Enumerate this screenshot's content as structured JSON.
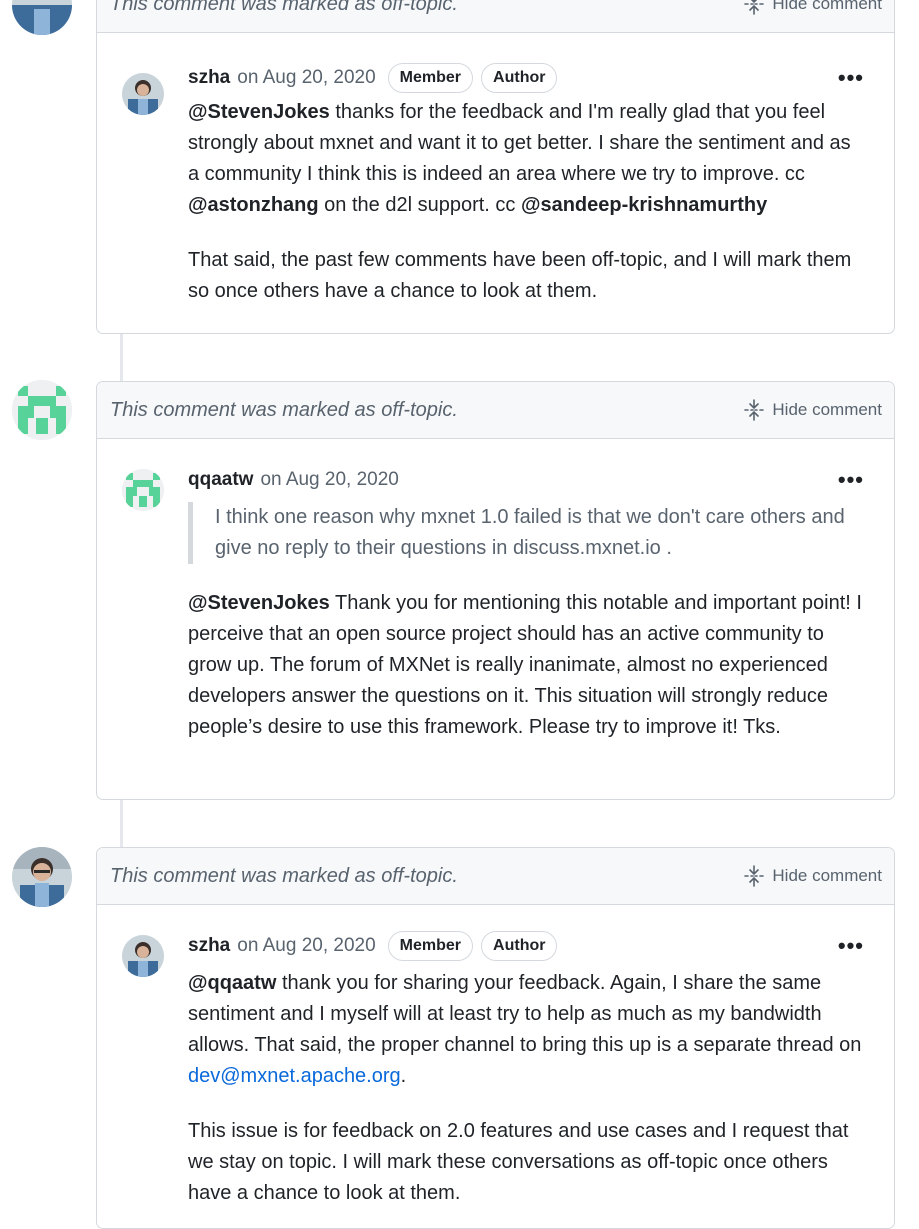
{
  "header_labels": {
    "off_topic": "This comment was marked as off-topic.",
    "hide": "Hide comment"
  },
  "badges": {
    "member": "Member",
    "author": "Author"
  },
  "top_partial": {
    "off_topic": "This comment was marked as off-topic.",
    "hide": "Hide comment"
  },
  "comment1": {
    "author": "szha",
    "date": "on Aug 20, 2020",
    "p1": {
      "m1": "@StevenJokes",
      "t1": " thanks for the feedback and I'm really glad that you feel strongly about mxnet and want it to get better. I share the sentiment and as a community I think this is indeed an area where we try to improve. cc ",
      "m2": "@astonzhang",
      "t2": " on the d2l support. cc ",
      "m3": "@sandeep-krishnamurthy"
    },
    "p2": "That said, the past few comments have been off-topic, and I will mark them so once others have a chance to look at them."
  },
  "comment2": {
    "author": "qqaatw",
    "date": "on Aug 20, 2020",
    "quote": "I think one reason why mxnet 1.0 failed is that we don't care others and give no reply to their questions in discuss.mxnet.io .",
    "mention": "@StevenJokes",
    "text": " Thank you for mentioning this notable and important point! I perceive that an open source project should has an active community to grow up. The forum of MXNet is really inanimate, almost no experienced developers answer the questions on it. This situation will strongly reduce people’s desire to use this framework. Please try to improve it! Tks."
  },
  "comment3": {
    "author": "szha",
    "date": "on Aug 20, 2020",
    "p1": {
      "mention": "@qqaatw",
      "text": " thank you for sharing your feedback. Again, I share the same sentiment and I myself will at least try to help as much as my bandwidth allows. That said, the proper channel to bring this up is a separate thread on ",
      "link": "dev@mxnet.apache.org",
      "end": "."
    },
    "p2": "This issue is for feedback on 2.0 features and use cases and I request that we stay on topic. I will mark these conversations as off-topic once others have a chance to look at them."
  },
  "kebab": "•••",
  "icons": {
    "hide": "fold-icon",
    "menu": "kebab-icon"
  },
  "colors": {
    "link": "#0969da",
    "muted": "#59636e",
    "border": "#d5d9de",
    "header_bg": "#f6f8fa",
    "identicon": "#57d39a"
  }
}
